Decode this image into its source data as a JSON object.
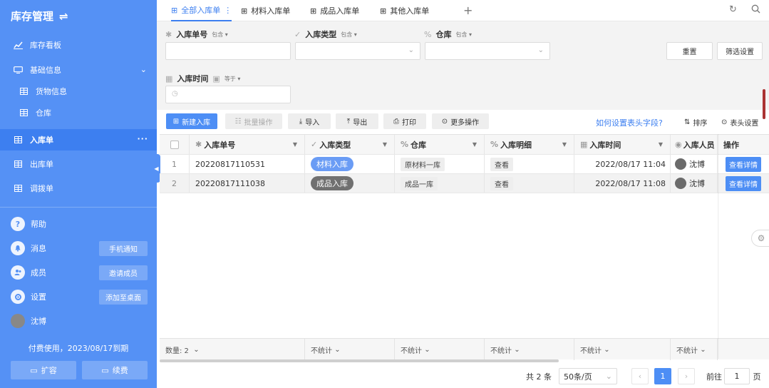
{
  "sidebar": {
    "title": "库存管理",
    "nav": [
      {
        "label": "库存看板",
        "icon": "chart-line-icon"
      },
      {
        "label": "基础信息",
        "icon": "monitor-icon"
      },
      {
        "label": "货物信息",
        "icon": "table-icon"
      },
      {
        "label": "仓库",
        "icon": "table-icon"
      },
      {
        "label": "入库单",
        "icon": "table-icon"
      },
      {
        "label": "出库单",
        "icon": "table-icon"
      },
      {
        "label": "调拨单",
        "icon": "table-icon"
      }
    ],
    "bottom": [
      {
        "label": "帮助",
        "icon": "question-icon"
      },
      {
        "label": "消息",
        "icon": "bell-icon",
        "pill": "手机通知"
      },
      {
        "label": "成员",
        "icon": "users-icon",
        "pill": "邀请成员"
      },
      {
        "label": "设置",
        "icon": "gear-icon",
        "pill": "添加至桌面"
      },
      {
        "label": "沈博",
        "icon": "avatar-icon"
      }
    ],
    "paid_text": "付费使用，2023/08/17到期",
    "expand_button": "扩容",
    "renew_button": "续费"
  },
  "tabs": [
    "全部入库单",
    "材料入库单",
    "成品入库单",
    "其他入库单"
  ],
  "filters": {
    "f1": {
      "label": "入库单号",
      "op": "包含"
    },
    "f2": {
      "label": "入库类型",
      "op": "包含"
    },
    "f3": {
      "label": "仓库",
      "op": "包含"
    },
    "f4": {
      "label": "入库时间",
      "op": "等于"
    },
    "reset": "重置",
    "settings": "筛选设置"
  },
  "toolbar": {
    "new": "新建入库",
    "batch": "批量操作",
    "import": "导入",
    "export": "导出",
    "print": "打印",
    "more": "更多操作",
    "help_link": "如何设置表头字段?",
    "sort": "排序",
    "header_settings": "表头设置"
  },
  "table": {
    "columns": [
      "入库单号",
      "入库类型",
      "仓库",
      "入库明细",
      "入库时间",
      "入库人员",
      "操作"
    ],
    "rows": [
      {
        "idx": "1",
        "id": "20220817110531",
        "type": "材料入库",
        "warehouse": "原材料一库",
        "detail": "查看",
        "time": "2022/08/17 11:04",
        "person": "沈博",
        "action": "查看详情"
      },
      {
        "idx": "2",
        "id": "20220817111038",
        "type": "成品入库",
        "warehouse": "成品一库",
        "detail": "查看",
        "time": "2022/08/17 11:08",
        "person": "沈博",
        "action": "查看详情"
      }
    ],
    "footer_count": "数量: 2",
    "footer_stat": "不统计"
  },
  "pager": {
    "total": "共 2 条",
    "per_page": "50条/页",
    "current": "1",
    "goto_prefix": "前往",
    "goto_value": "1",
    "goto_suffix": "页"
  },
  "colors": {
    "sidebar": "#5591f5",
    "primary": "#4d8ef5"
  }
}
